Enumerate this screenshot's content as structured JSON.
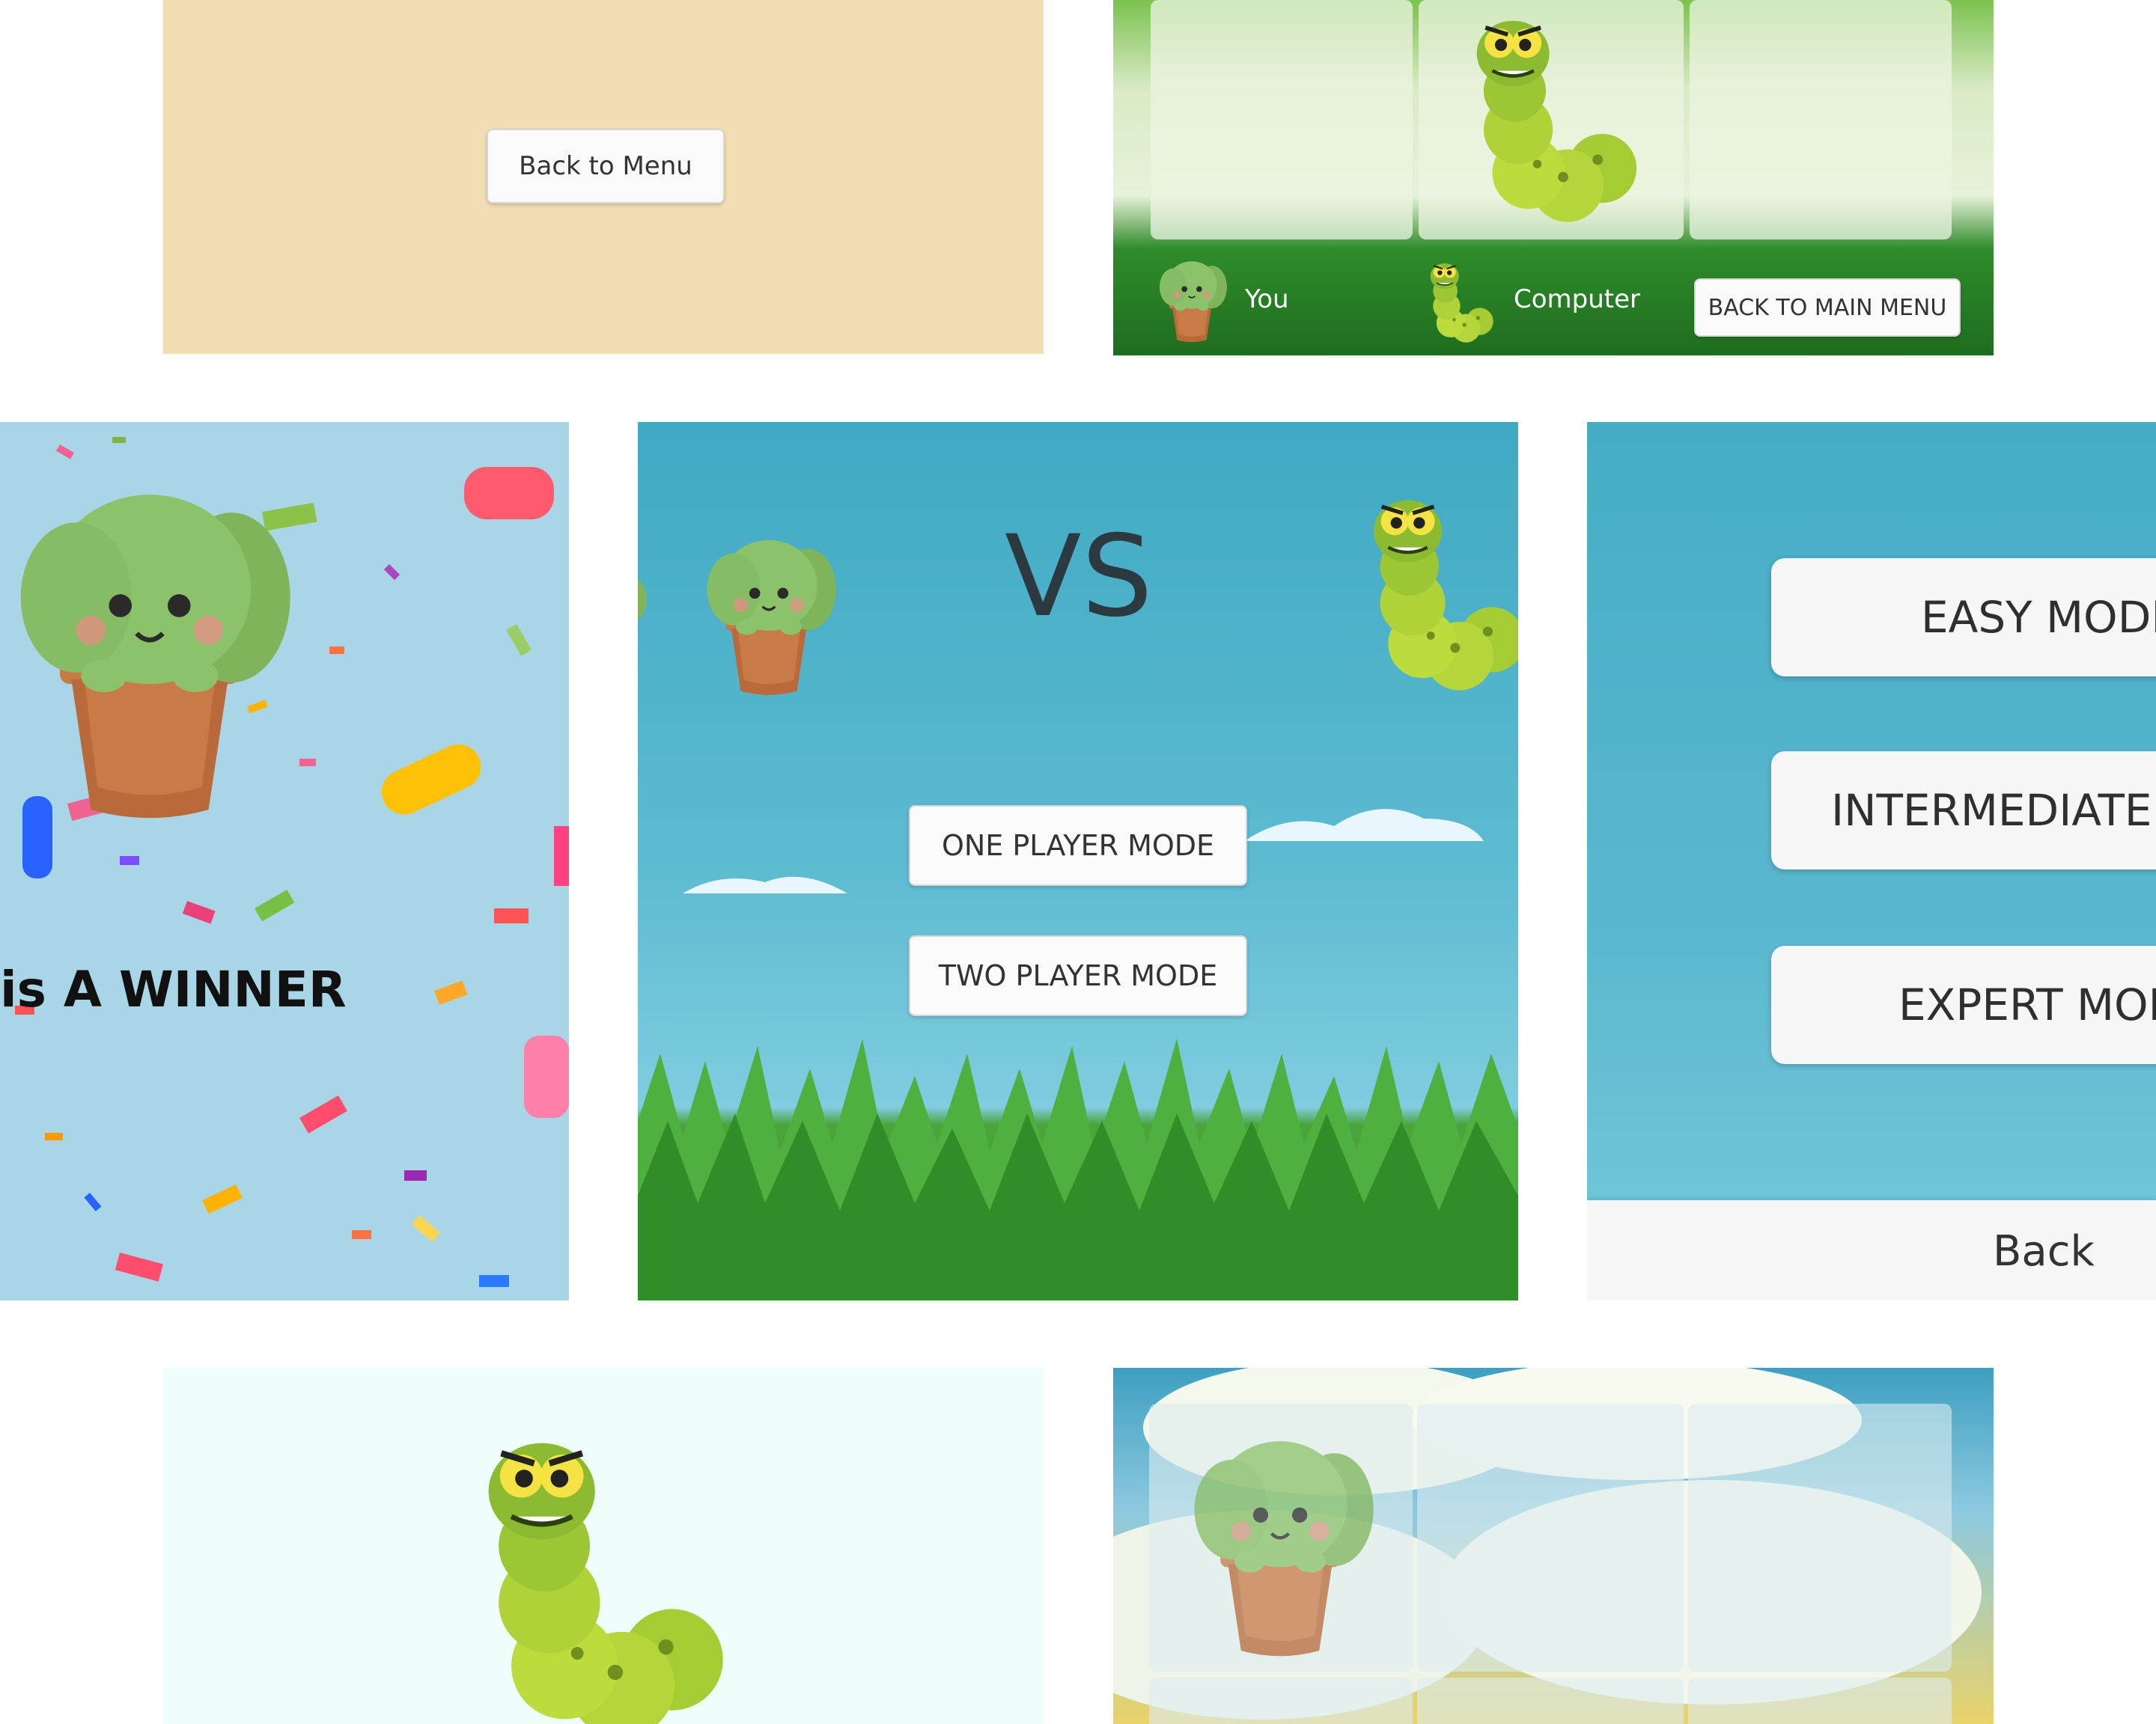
{
  "tiles": {
    "menu_return": {
      "button": "Back to Menu",
      "bg_color": "#f3ddb2"
    },
    "game_board_grass": {
      "player1_label": "You",
      "player2_label": "Computer",
      "back_button": "BACK TO MAIN MENU"
    },
    "winner": {
      "text": "is A WINNER",
      "bg_color": "#a9d6e6"
    },
    "title_screen": {
      "vs_text": "VS",
      "one_player_button": "ONE PLAYER MODE",
      "two_player_button": "TWO PLAYER MODE"
    },
    "difficulty": {
      "easy_button": "EASY MODE",
      "intermediate_button": "INTERMEDIATE M",
      "expert_button": "EXPERT MODI",
      "back_button": "Back"
    },
    "caterpillar_splash": {
      "bg_color": "#effdfd"
    },
    "game_board_sky": {}
  },
  "colors": {
    "sky": "#47aec6",
    "grass": "#46a83a",
    "cactus": "#8cc26a",
    "pot": "#c0703d",
    "caterpillar": "#b6d63c"
  },
  "icons": [
    "cactus-character",
    "caterpillar-character",
    "cloud",
    "confetti"
  ]
}
